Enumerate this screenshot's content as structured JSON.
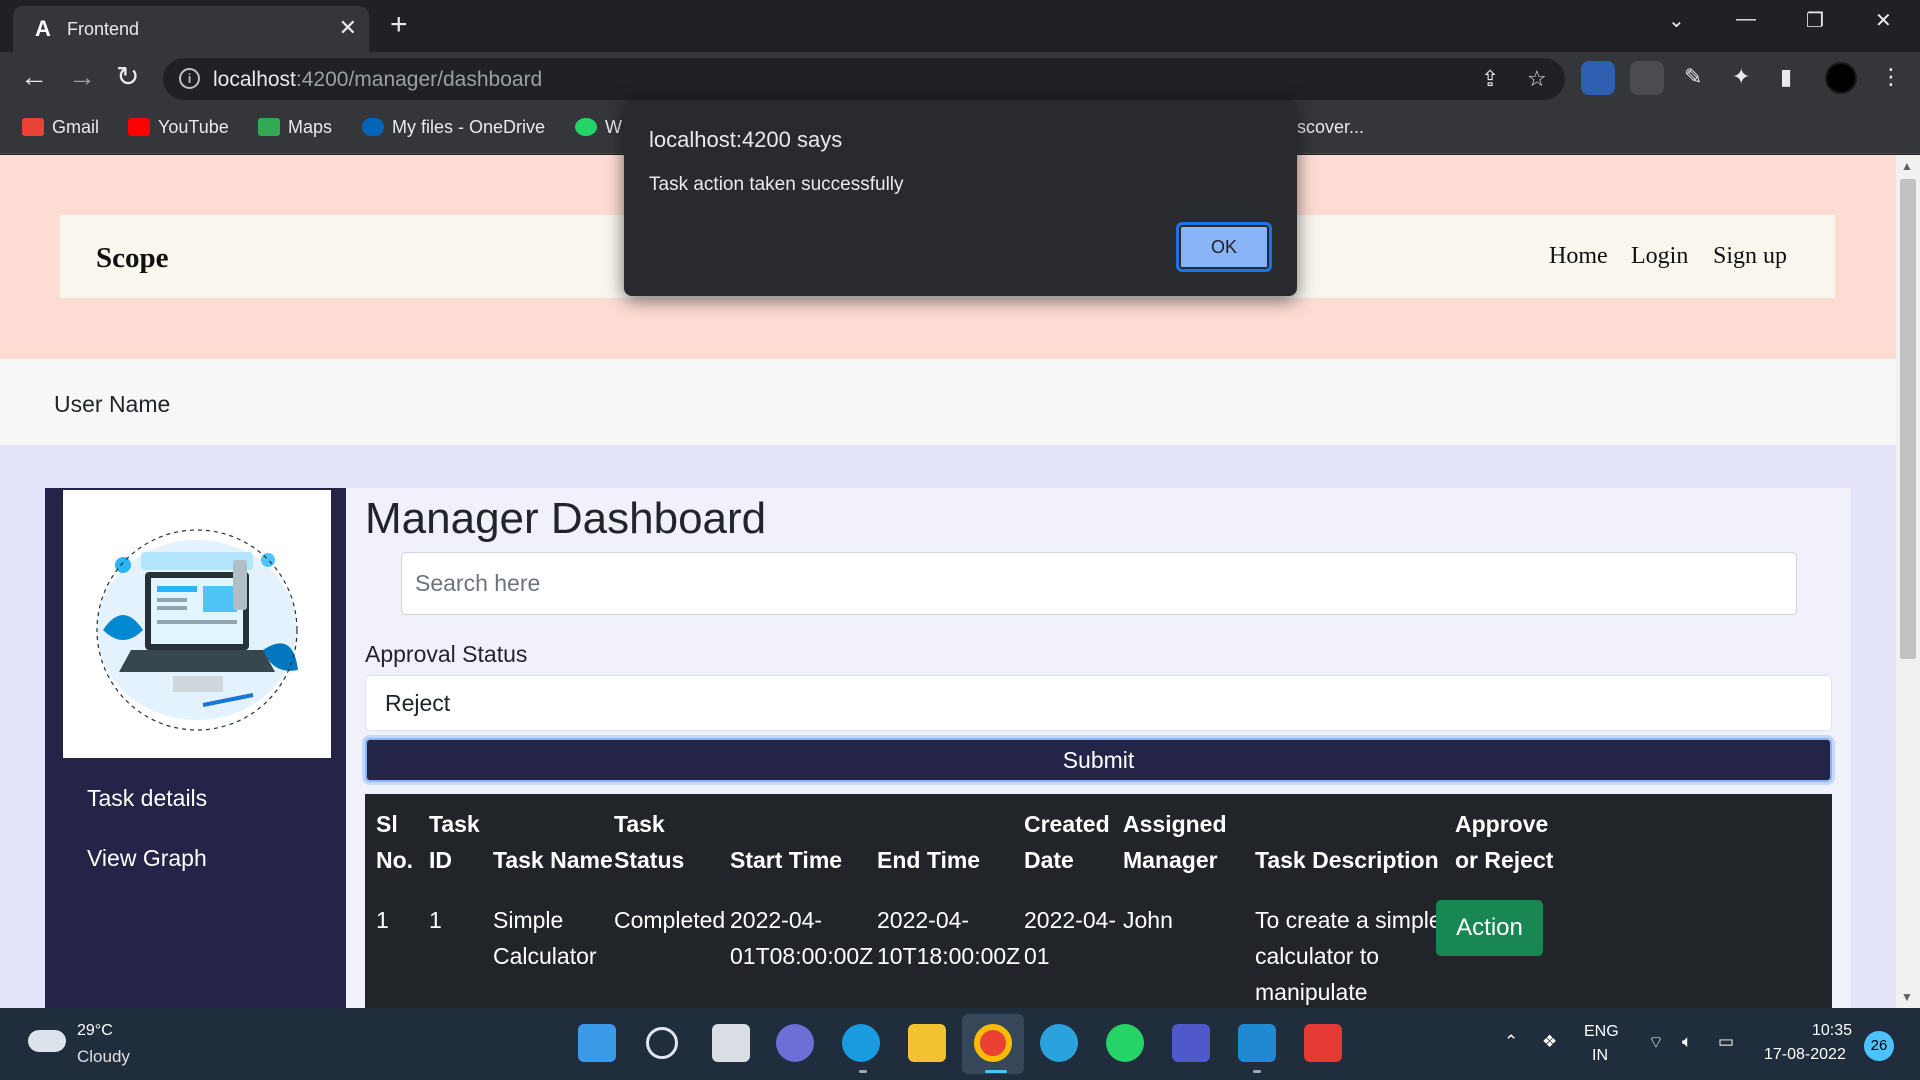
{
  "browser": {
    "tab_title": "Frontend",
    "tab_favicon": "A",
    "url_host": "localhost",
    "url_path": ":4200/manager/dashboard",
    "bookmarks": [
      {
        "label": "Gmail",
        "icon": "gmail-icon",
        "color": "#ea4335"
      },
      {
        "label": "YouTube",
        "icon": "youtube-icon",
        "color": "#ff0000"
      },
      {
        "label": "Maps",
        "icon": "maps-icon",
        "color": "#34a853"
      },
      {
        "label": "My files - OneDrive",
        "icon": "onedrive-icon",
        "color": "#0364b8"
      },
      {
        "label": "W",
        "icon": "whatsapp-icon",
        "color": "#25d366"
      },
      {
        "label": "scover...",
        "icon": "",
        "color": ""
      }
    ]
  },
  "page": {
    "brand": "Scope",
    "nav": [
      "Home",
      "Login",
      "Sign up"
    ],
    "user_name": "User Name",
    "sidebar": {
      "illustration": "laptop-illustration",
      "links": [
        "Task details",
        "View Graph"
      ]
    },
    "dashboard_title": "Manager Dashboard",
    "search_placeholder": "Search here",
    "approval_label": "Approval Status",
    "approval_value": "Reject",
    "submit_label": "Submit",
    "table": {
      "headers": [
        [
          "Sl",
          "No."
        ],
        [
          "Task",
          "ID"
        ],
        [
          "",
          "Task Name"
        ],
        [
          "Task",
          "Status"
        ],
        [
          "",
          "Start Time"
        ],
        [
          "",
          "End Time"
        ],
        [
          "Created",
          "Date"
        ],
        [
          "Assigned",
          "Manager"
        ],
        [
          "",
          "Task Description"
        ],
        [
          "Approve",
          "or Reject"
        ]
      ],
      "rows": [
        {
          "sl": "1",
          "task_id": "1",
          "task_name": [
            "Simple",
            "Calculator"
          ],
          "status": "Completed",
          "start_time": [
            "2022-04-",
            "01T08:00:00Z"
          ],
          "end_time": [
            "2022-04-",
            "10T18:00:00Z"
          ],
          "created": [
            "2022-04-",
            "01"
          ],
          "manager": "John",
          "description": [
            "To create a simple",
            "calculator to",
            "manipulate"
          ],
          "action_label": "Action"
        }
      ]
    }
  },
  "alert": {
    "title": "localhost:4200 says",
    "message": "Task action taken successfully",
    "ok_label": "OK"
  },
  "taskbar": {
    "temperature": "29°C",
    "condition": "Cloudy",
    "lang_top": "ENG",
    "lang_bottom": "IN",
    "time": "10:35",
    "date": "17-08-2022",
    "notification_count": "26"
  },
  "colors": {
    "navy": "#232447",
    "hero": "#fddcd4",
    "success": "#198754",
    "dialog_accent": "#8ab4f8"
  }
}
